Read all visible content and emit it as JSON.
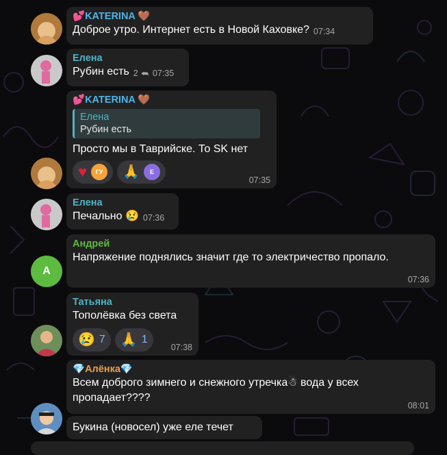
{
  "colors": {
    "background": "#0b0b0d",
    "bubble": "#212121",
    "katerina_name": "#4fb4e8",
    "elena_name": "#4fb4c6",
    "andrey_name": "#5dbb3f",
    "tatyana_name": "#4fb4c6",
    "alenka_name": "#e9a04a",
    "reaction_count": "#8ab4ff"
  },
  "messages": [
    {
      "sender": "KATERINA",
      "sender_prefix_icon": "hearts-emoji",
      "sender_suffix_icon": "brown-heart-emoji",
      "text": "Доброе утро. Интернет есть в Новой Каховке?",
      "time": "07:34"
    },
    {
      "sender": "Елена",
      "text": "Рубин есть",
      "reply_count": "2",
      "time": "07:35"
    },
    {
      "sender": "KATERINA",
      "sender_prefix_icon": "hearts-emoji",
      "sender_suffix_icon": "brown-heart-emoji",
      "reply_to": {
        "name": "Елена",
        "text": "Рубин есть"
      },
      "text": "Просто мы в Таврийске. То SK нет",
      "reactions": [
        {
          "emoji": "heart",
          "user_initials": "ГУ",
          "user_color": "#f2a33a"
        },
        {
          "emoji": "pray",
          "user_initials": "Е",
          "user_color": "#8a6ee0"
        }
      ],
      "time": "07:35"
    },
    {
      "sender": "Елена",
      "text": "Печально",
      "text_suffix_icon": "crying-face-emoji",
      "time": "07:36"
    },
    {
      "sender": "Андрей",
      "avatar_letter": "A",
      "text": "Напряжение поднялись значит где то электричество пропало.",
      "time": "07:36"
    },
    {
      "sender": "Татьяна",
      "text": "Тополёвка без света",
      "reactions": [
        {
          "emoji": "crying-face",
          "count": "7"
        },
        {
          "emoji": "pray",
          "count": "1"
        }
      ],
      "time": "07:38"
    },
    {
      "sender": "Алёнка",
      "sender_prefix_icon": "gem-emoji",
      "sender_suffix_icon": "gem-emoji",
      "text": "Всем доброго зимнего и снежного утречка",
      "text_icon": "snowman-emoji",
      "text_continued": " вода у всех пропадает????",
      "time": "08:01"
    },
    {
      "text": "Букина (новосел) уже еле течет"
    }
  ]
}
